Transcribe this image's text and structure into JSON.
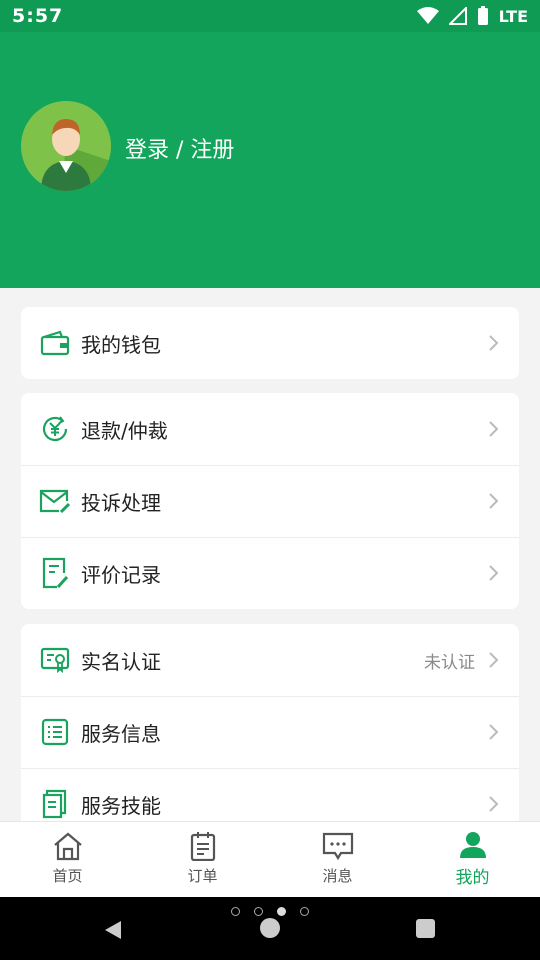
{
  "status_bar": {
    "time": "5:57",
    "network": "LTE"
  },
  "header": {
    "login_text": "登录 / 注册"
  },
  "menu": {
    "wallet": "我的钱包",
    "refund": "退款/仲裁",
    "complaint": "投诉处理",
    "reviews": "评价记录",
    "verification": "实名认证",
    "verification_status": "未认证",
    "service_info": "服务信息",
    "service_skills": "服务技能"
  },
  "tabs": {
    "home": "首页",
    "orders": "订单",
    "messages": "消息",
    "mine": "我的"
  },
  "colors": {
    "brand": "#12a55b",
    "status_bar": "#109b54",
    "icon_green": "#1aa35e"
  },
  "icons": [
    "wallet-icon",
    "yuan-refund-icon",
    "mail-edit-icon",
    "document-edit-icon",
    "certificate-icon",
    "list-icon",
    "copy-doc-icon",
    "home-icon",
    "clipboard-icon",
    "chat-icon",
    "person-icon"
  ]
}
